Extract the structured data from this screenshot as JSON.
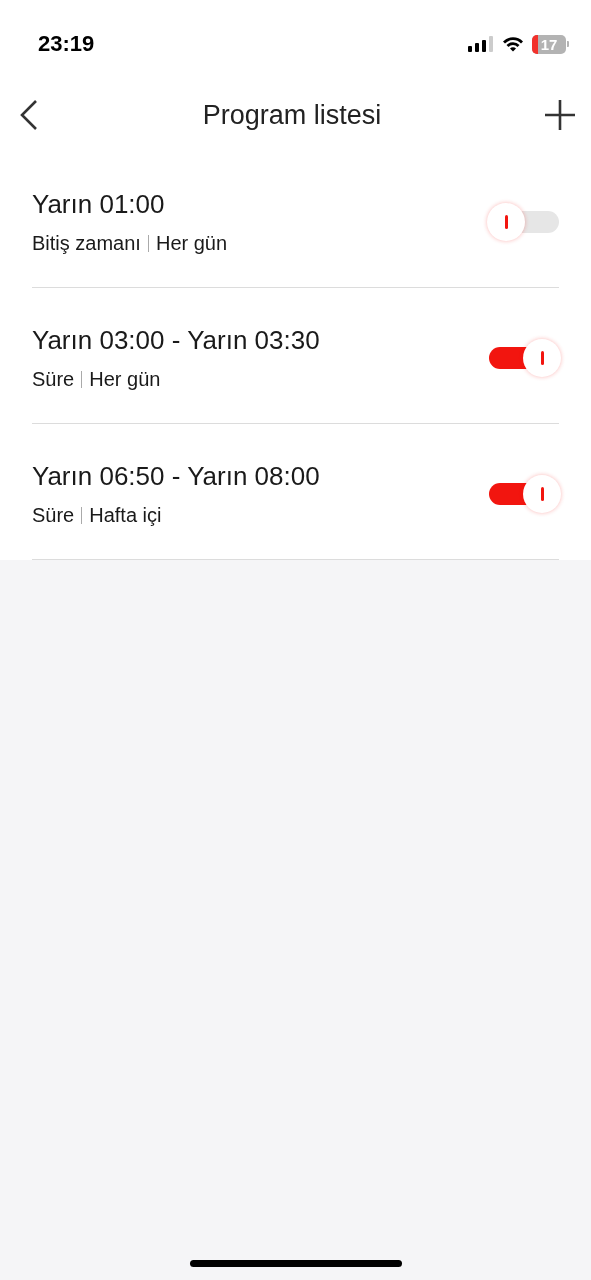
{
  "status_bar": {
    "time": "23:19",
    "battery": "17"
  },
  "nav": {
    "title": "Program listesi"
  },
  "programs": [
    {
      "time": "Yarın 01:00",
      "mode": "Bitiş zamanı",
      "repeat": "Her gün",
      "on": false
    },
    {
      "time": "Yarın 03:00 - Yarın 03:30",
      "mode": "Süre",
      "repeat": "Her gün",
      "on": true
    },
    {
      "time": "Yarın 06:50 - Yarın 08:00",
      "mode": "Süre",
      "repeat": "Hafta içi",
      "on": true
    }
  ]
}
